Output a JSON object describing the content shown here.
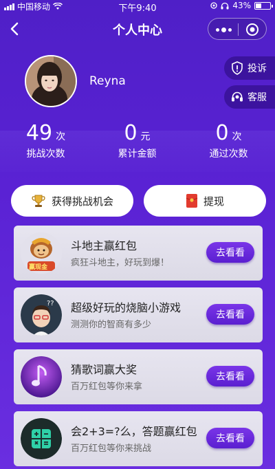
{
  "status_bar": {
    "carrier": "中国移动",
    "time": "下午9:40",
    "battery": "43%"
  },
  "nav": {
    "title": "个人中心"
  },
  "profile": {
    "username": "Reyna",
    "complain_label": "投诉",
    "service_label": "客服"
  },
  "stats": [
    {
      "value": "49",
      "unit": "次",
      "label": "挑战次数"
    },
    {
      "value": "0",
      "unit": "元",
      "label": "累计金额"
    },
    {
      "value": "0",
      "unit": "次",
      "label": "通过次数"
    }
  ],
  "actions": {
    "get_chance": "获得挑战机会",
    "withdraw": "提现"
  },
  "games": [
    {
      "title": "斗地主赢红包",
      "subtitle": "疯狂斗地主，好玩到爆！",
      "button": "去看看",
      "thumb_badge": "赢现金"
    },
    {
      "title": "超级好玩的烧脑小游戏",
      "subtitle": "测测你的智商有多少",
      "button": "去看看"
    },
    {
      "title": "猜歌词赢大奖",
      "subtitle": "百万红包等你来拿",
      "button": "去看看"
    },
    {
      "title": "会2+3=?么，答题赢红包",
      "subtitle": "百万红包等你来挑战",
      "button": "去看看"
    }
  ],
  "colors": {
    "background": "#5a22d4",
    "button_accent": "#6a2ee0",
    "card_bg": "#e3e1ec"
  },
  "icons": {
    "back": "back-arrow-icon",
    "more": "more-dots-icon",
    "close": "target-close-icon",
    "complain": "shield-exclamation-icon",
    "service": "headset-icon",
    "trophy": "trophy-icon",
    "redpacket": "red-envelope-icon"
  }
}
